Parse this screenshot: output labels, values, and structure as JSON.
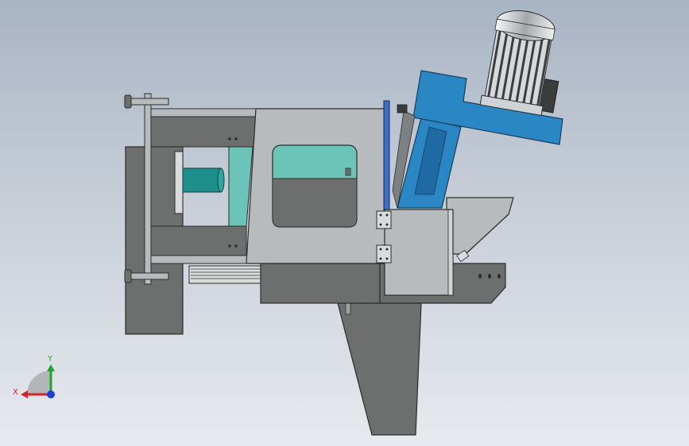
{
  "viewport": {
    "background_top": "#a9b4c4",
    "background_bottom": "#e7eaee"
  },
  "triad": {
    "x_label": "X",
    "y_label": "Y",
    "x_color": "#d4202a",
    "y_color": "#22a52a",
    "z_color": "#1d3fd6"
  },
  "colors": {
    "body_grey": "#6c6f6d",
    "plate_grey": "#b8bbbe",
    "dark_grey": "#5f625f",
    "teal": "#6cc3b8",
    "motor_blue": "#2b86c4",
    "motor_silver": "#cfd3d6"
  }
}
